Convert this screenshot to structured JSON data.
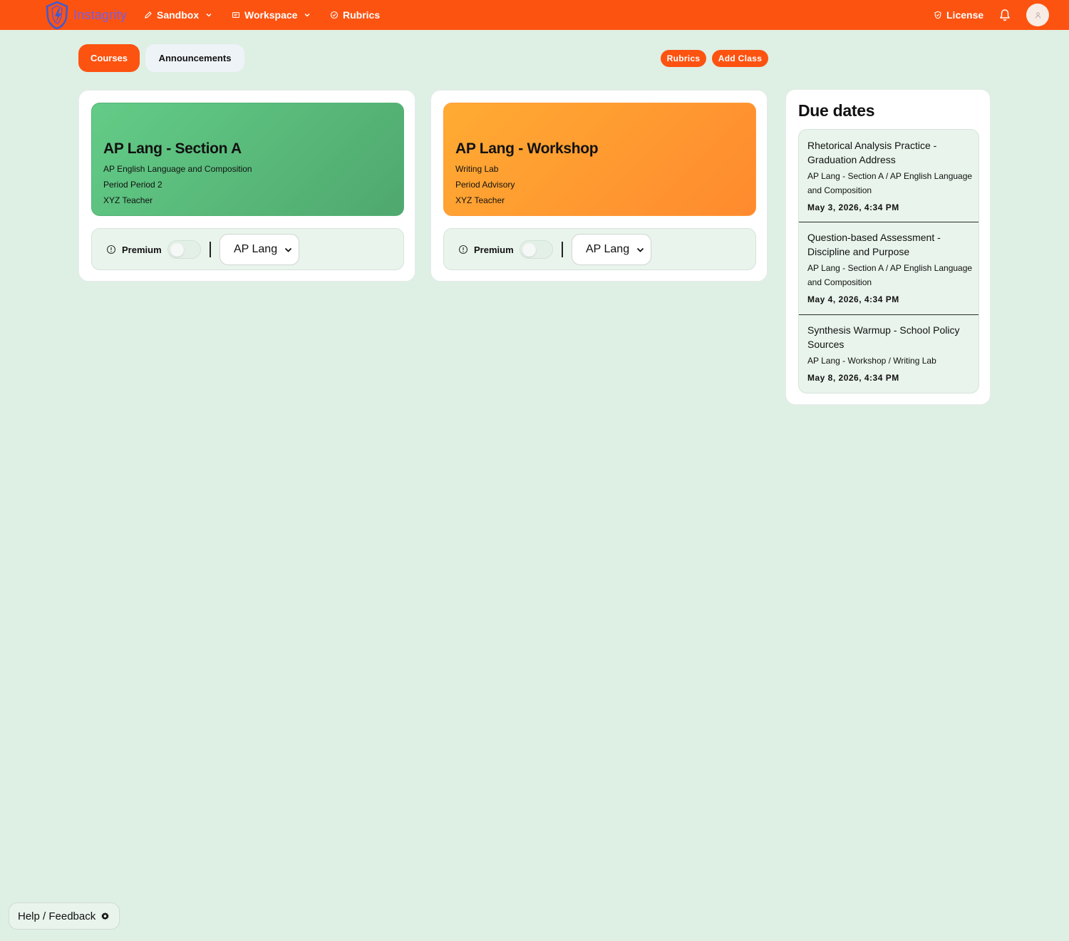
{
  "colors": {
    "brand": "#fd5310",
    "background": "#deefe4",
    "card_green": "#5fc283",
    "card_orange": "#ff9a30",
    "logo_text": "#7a5ce0"
  },
  "nav": {
    "logo_text": "Instagrity",
    "sandbox": "Sandbox",
    "workspace": "Workspace",
    "rubrics": "Rubrics",
    "license": "License",
    "icons": [
      "shield-logo-icon",
      "pencil-icon",
      "chevron-down-icon",
      "document-icon",
      "check-circle-icon",
      "shield-check-icon",
      "bell-icon",
      "user-icon"
    ]
  },
  "tabs": {
    "courses": "Courses",
    "announcements": "Announcements"
  },
  "actions": {
    "rubrics": "Rubrics",
    "add_class": "Add Class"
  },
  "courses": [
    {
      "title": "AP Lang - Section A",
      "subtitle": "AP English Language and Composition",
      "period": "Period Period 2",
      "teacher": "XYZ Teacher",
      "premium_label": "Premium",
      "premium_on": false,
      "select_value": "AP Lang"
    },
    {
      "title": "AP Lang - Workshop",
      "subtitle": "Writing Lab",
      "period": "Period Advisory",
      "teacher": "XYZ Teacher",
      "premium_label": "Premium",
      "premium_on": false,
      "select_value": "AP Lang"
    }
  ],
  "due": {
    "title": "Due dates",
    "items": [
      {
        "title": "Rhetorical Analysis Practice - Graduation Address",
        "course": "AP Lang - Section A / AP English Language and Composition",
        "date": "May 3, 2026, 4:34 PM"
      },
      {
        "title": "Question-based Assessment - Discipline and Purpose",
        "course": "AP Lang - Section A / AP English Language and Composition",
        "date": "May 4, 2026, 4:34 PM"
      },
      {
        "title": "Synthesis Warmup - School Policy Sources",
        "course": "AP Lang - Workshop / Writing Lab",
        "date": "May 8, 2026, 4:34 PM"
      }
    ]
  },
  "help": {
    "label": "Help / Feedback"
  }
}
